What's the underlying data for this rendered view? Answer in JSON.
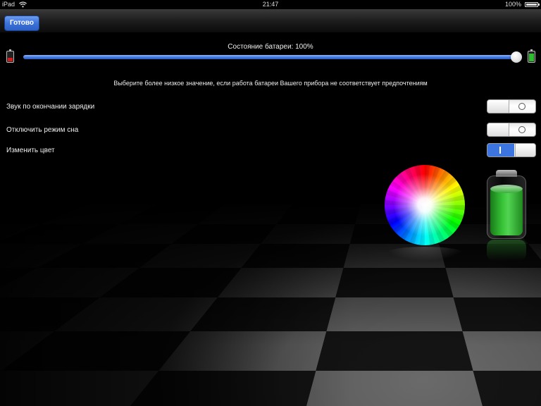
{
  "status_bar": {
    "device": "iPad",
    "time": "21:47",
    "battery_percent": "100%"
  },
  "toolbar": {
    "done_label": "Готово"
  },
  "battery": {
    "status_label": "Состояние батареи: 100%",
    "slider_level": 1.0,
    "hint": "Выберите более низкое значение, если работа батареи Вашего прибора не соответствует предпочтениям"
  },
  "settings": [
    {
      "label": "Звук по окончании зарядки",
      "enabled": false,
      "on_text": "I",
      "off_text": "O"
    },
    {
      "label": "Отключить режим сна",
      "enabled": false,
      "on_text": "I",
      "off_text": "O"
    },
    {
      "label": "Изменить цвет",
      "enabled": true,
      "on_text": "I",
      "off_text": "O"
    }
  ],
  "colors": {
    "accent": "#3c75e0",
    "battery_green": "#35c035",
    "low_battery_red": "#d41a1a"
  },
  "icons": {
    "wifi": "wifi-icon",
    "status_battery": "status-battery-icon",
    "low_battery": "low-battery-icon",
    "full_battery": "full-battery-icon",
    "color_wheel": "color-wheel",
    "big_battery": "big-battery-icon"
  }
}
